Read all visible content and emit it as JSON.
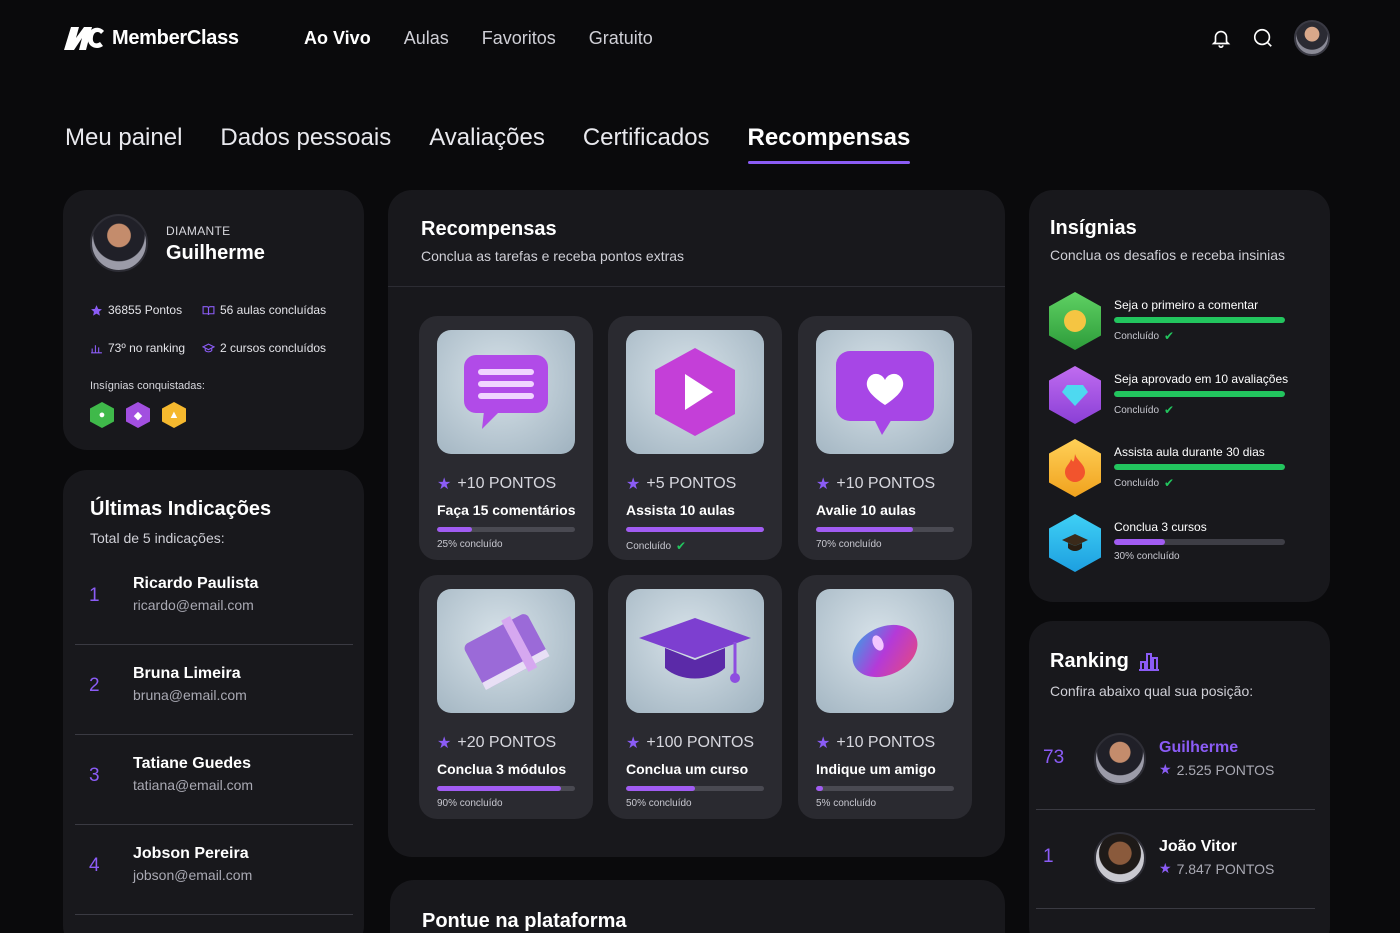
{
  "brand": {
    "name": "MemberClass",
    "accent": "#8b5cf6",
    "success": "#22c55e"
  },
  "nav": {
    "links": [
      "Ao Vivo",
      "Aulas",
      "Favoritos",
      "Gratuito"
    ]
  },
  "tabs": [
    "Meu painel",
    "Dados pessoais",
    "Avaliações",
    "Certificados",
    "Recompensas"
  ],
  "profile": {
    "tier": "DIAMANTE",
    "name": "Guilherme",
    "points": "36855 Pontos",
    "lessons": "56 aulas concluídas",
    "ranking": "73º no ranking",
    "courses": "2 cursos concluídos",
    "badges_label": "Insígnias conquistadas:"
  },
  "referrals": {
    "title": "Últimas Indicações",
    "subtitle": "Total de 5 indicações:",
    "items": [
      {
        "num": "1",
        "name": "Ricardo Paulista",
        "email": "ricardo@email.com"
      },
      {
        "num": "2",
        "name": "Bruna Limeira",
        "email": "bruna@email.com"
      },
      {
        "num": "3",
        "name": "Tatiane Guedes",
        "email": "tatiana@email.com"
      },
      {
        "num": "4",
        "name": "Jobson Pereira",
        "email": "jobson@email.com"
      }
    ]
  },
  "rewards": {
    "title": "Recompensas",
    "subtitle": "Conclua as tarefas e receba pontos extras",
    "tasks": [
      {
        "points": "+10 PONTOS",
        "name": "Faça 15 comentários",
        "status": "25% concluído",
        "progress": 0.25,
        "icon": "chat-icon"
      },
      {
        "points": "+5 PONTOS",
        "name": "Assista 10 aulas",
        "status": "Concluído",
        "progress": 1.0,
        "icon": "play-icon"
      },
      {
        "points": "+10 PONTOS",
        "name": "Avalie 10 aulas",
        "status": "70% concluído",
        "progress": 0.7,
        "icon": "heart-icon"
      },
      {
        "points": "+20 PONTOS",
        "name": "Conclua 3 módulos",
        "status": "90% concluído",
        "progress": 0.9,
        "icon": "book-icon"
      },
      {
        "points": "+100 PONTOS",
        "name": "Conclua um curso",
        "status": "50% concluído",
        "progress": 0.5,
        "icon": "graduation-cap-icon"
      },
      {
        "points": "+10 PONTOS",
        "name": "Indique um amigo",
        "status": "5% concluído",
        "progress": 0.05,
        "icon": "mouse-icon"
      }
    ]
  },
  "points_section": {
    "title": "Pontue na plataforma"
  },
  "insignias": {
    "title": "Insígnias",
    "subtitle": "Conclua os desafios e receba insinias",
    "items": [
      {
        "title": "Seja o primeiro a comentar",
        "status": "Concluído",
        "progress": 1.0,
        "icon": "medal-icon"
      },
      {
        "title": "Seja aprovado em 10 avaliações",
        "status": "Concluído",
        "progress": 1.0,
        "icon": "diamond-icon"
      },
      {
        "title": "Assista aula durante 30 dias",
        "status": "Concluído",
        "progress": 1.0,
        "icon": "fire-icon"
      },
      {
        "title": "Conclua 3 cursos",
        "status": "30% concluído",
        "progress": 0.3,
        "icon": "graduation-cap-icon"
      }
    ]
  },
  "ranking": {
    "title": "Ranking",
    "subtitle": "Confira abaixo qual sua posição:",
    "rows": [
      {
        "pos": "73",
        "name": "Guilherme",
        "points": "2.525 PONTOS",
        "highlight": true
      },
      {
        "pos": "1",
        "name": "João Vitor",
        "points": "7.847 PONTOS",
        "highlight": false
      }
    ]
  }
}
